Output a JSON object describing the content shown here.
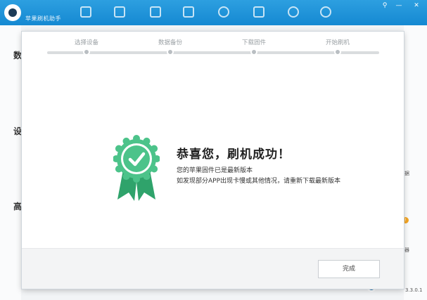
{
  "app": {
    "title": "苹果刷机助手",
    "version": "3.3.0.1",
    "window_controls": [
      "⚲",
      "—",
      "✕"
    ]
  },
  "sidebar": {
    "labels": [
      "数",
      "设",
      "高"
    ]
  },
  "right_panel": {
    "texts": [
      "据",
      "器"
    ],
    "badge": "!"
  },
  "dialog": {
    "steps": [
      {
        "label": "选择设备"
      },
      {
        "label": "数据备份"
      },
      {
        "label": "下载固件"
      },
      {
        "label": "开始刷机"
      }
    ],
    "success": {
      "title": "恭喜您，刷机成功！",
      "line1": "您的苹果固件已是最新版本",
      "line2": "如发现部分APP出现卡慢或其他情况，请重新下载最新版本"
    },
    "done_label": "完成"
  },
  "colors": {
    "brand_blue": "#1589d2",
    "success_green": "#4cc38a",
    "badge_dark_green": "#2fa36b",
    "step_gray": "#b9bec2"
  },
  "icons": {
    "badge": "success-rosette-check-icon",
    "logo": "app-eye-logo-icon"
  }
}
